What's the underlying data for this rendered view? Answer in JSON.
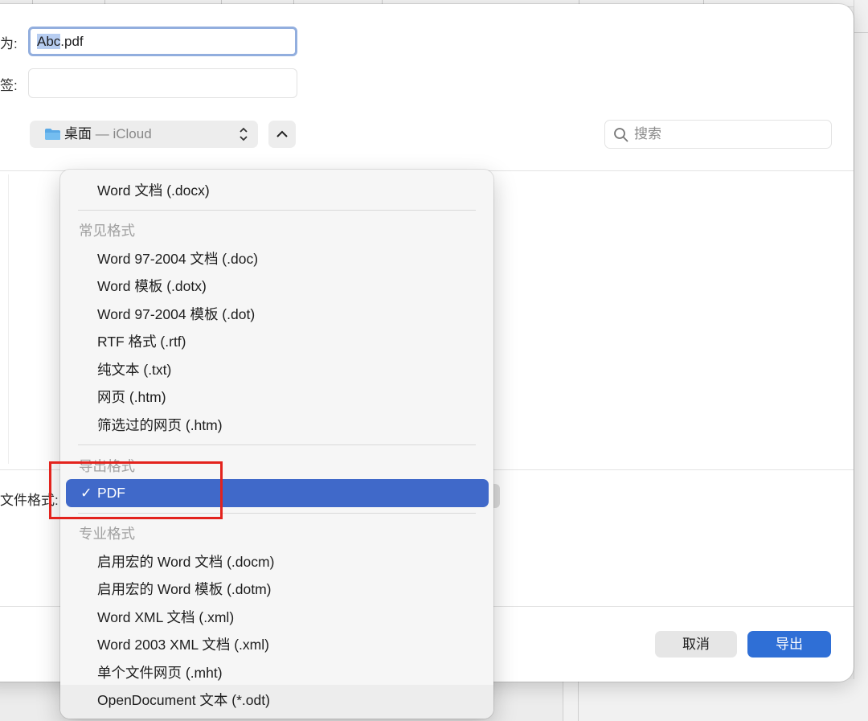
{
  "labels": {
    "save_as": "为:",
    "tags": "签:",
    "file_format": "文件格式:"
  },
  "fields": {
    "name_value_selected": "Abc",
    "name_value_rest": ".pdf",
    "tags_value": ""
  },
  "location": {
    "folder_name": "桌面",
    "separator": " — ",
    "cloud": "iCloud",
    "updown_glyph": "⌃⌄"
  },
  "search": {
    "placeholder": "搜索"
  },
  "buttons": {
    "cancel": "取消",
    "export": "导出"
  },
  "menu": {
    "top_item": "Word 文档 (.docx)",
    "common_header": "常见格式",
    "common_items": [
      "Word 97-2004 文档 (.doc)",
      "Word 模板 (.dotx)",
      "Word 97-2004 模板 (.dot)",
      "RTF 格式 (.rtf)",
      "纯文本 (.txt)",
      "网页 (.htm)",
      "筛选过的网页 (.htm)"
    ],
    "export_header": "导出格式",
    "selected_item": "PDF",
    "check_glyph": "✓",
    "pro_header": "专业格式",
    "pro_items": [
      "启用宏的 Word 文档 (.docm)",
      "启用宏的 Word 模板 (.dotm)",
      "Word XML 文档 (.xml)",
      "Word 2003 XML 文档 (.xml)",
      "单个文件网页 (.mht)",
      "OpenDocument 文本 (*.odt)"
    ]
  },
  "colors": {
    "accent": "#2f6fd6",
    "menu_selection": "#4069c9",
    "highlight_box": "#e3231d"
  },
  "icons": {
    "folder": "folder-icon",
    "search": "magnifier-icon",
    "chevron": "chevron-up-icon",
    "updown": "updown-chevron-icon"
  }
}
